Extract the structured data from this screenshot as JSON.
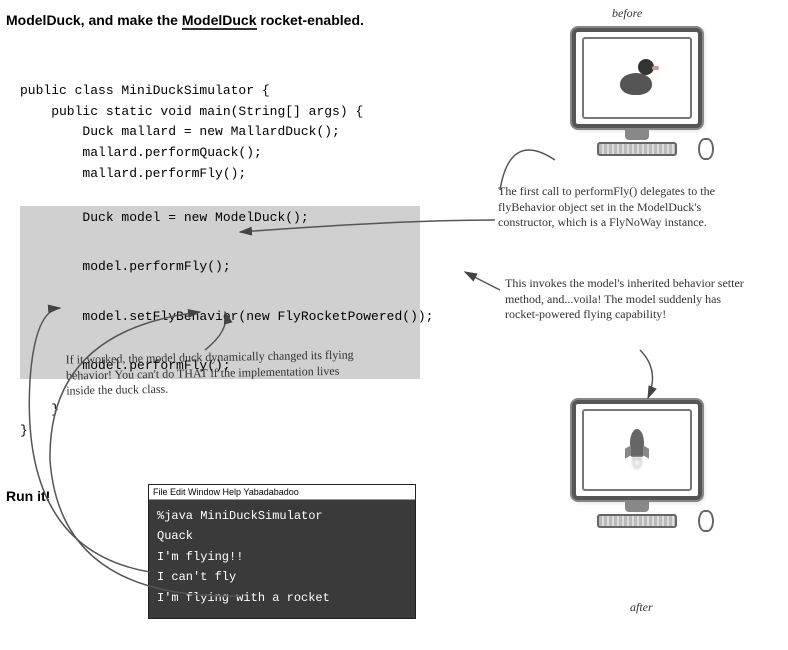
{
  "heading": {
    "prefix": "ModelDuck, and make the ",
    "bold_word": "ModelDuck",
    "suffix": " rocket-enabled."
  },
  "code": {
    "line1": "public class MiniDuckSimulator {",
    "line2": "    public static void main(String[] args) {",
    "line3": "        Duck mallard = new MallardDuck();",
    "line4": "        mallard.performQuack();",
    "line5": "        mallard.performFly();",
    "hl1": "        Duck model = new ModelDuck();",
    "hl2": "        model.performFly();",
    "hl3": "        model.setFlyBehavior(new FlyRocketPowered());",
    "hl4": "        model.performFly();",
    "end1": "    }",
    "end2": "}"
  },
  "annotations": {
    "before": "before",
    "after": "after",
    "a1": "The first call to performFly() delegates to the flyBehavior object set in the ModelDuck's constructor, which is a FlyNoWay instance.",
    "a2": "This invokes the model's inherited behavior setter method, and...voila! The model suddenly has rocket-powered flying capability!",
    "a3": "If it worked, the model duck dynamically changed its flying behavior! You can't do THAT if the implementation lives inside the duck class."
  },
  "run_label": "Run it!",
  "terminal": {
    "menu": "File Edit Window Help Yabadabadoo",
    "lines": {
      "l1": "%java MiniDuckSimulator",
      "l2": "Quack",
      "l3": "I'm flying!!",
      "l4": "I can't fly",
      "l5": "I'm flying with a rocket"
    }
  }
}
